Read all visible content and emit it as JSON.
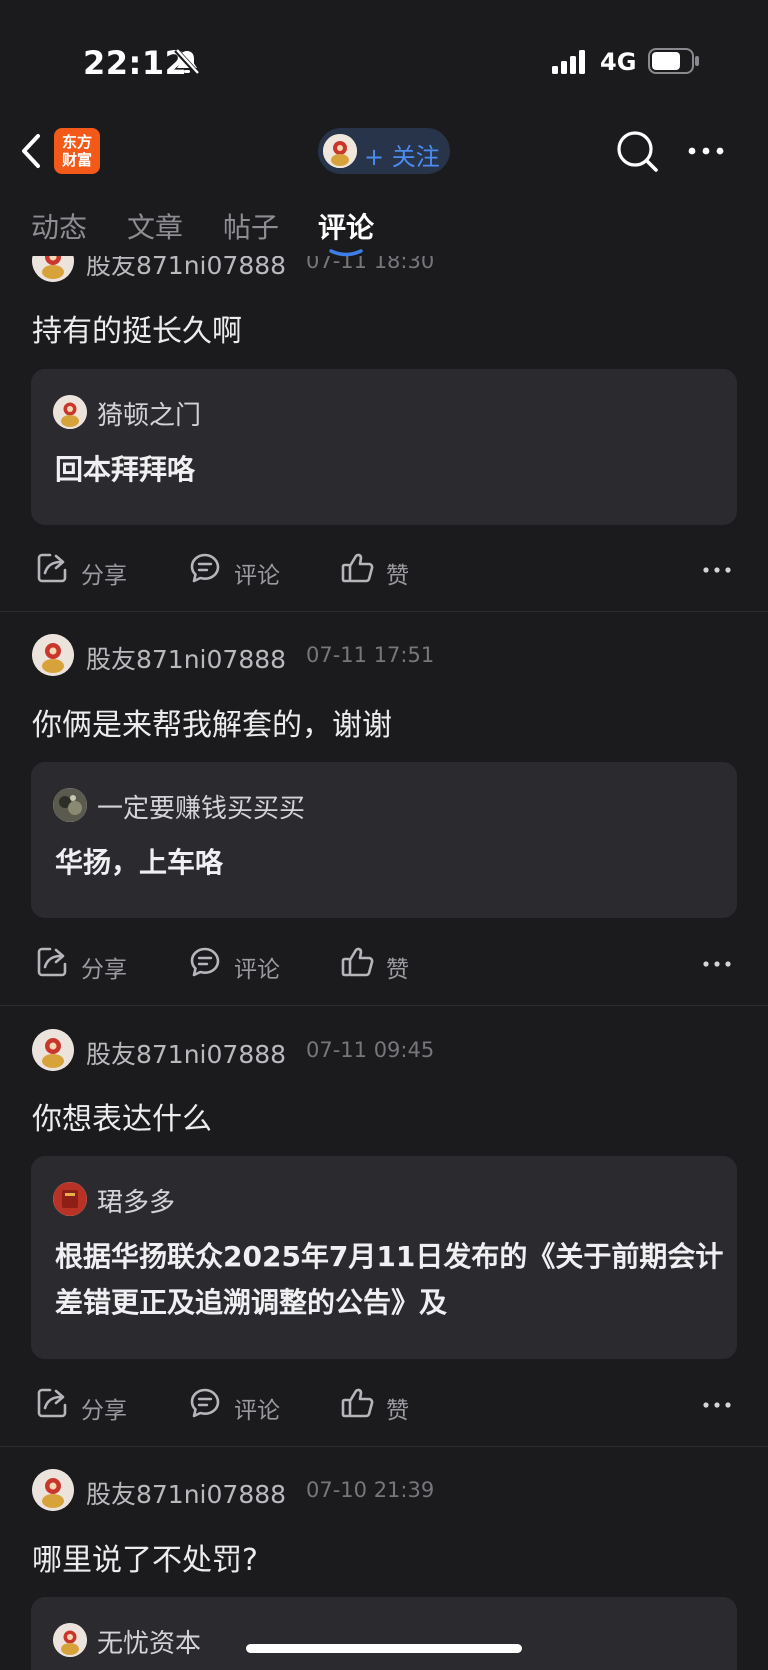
{
  "status": {
    "time": "22:12",
    "network": "4G"
  },
  "nav": {
    "logo_line1": "东方",
    "logo_line2": "财富",
    "follow_label": "+ 关注"
  },
  "tabs": [
    {
      "label": "动态"
    },
    {
      "label": "文章"
    },
    {
      "label": "帖子"
    },
    {
      "label": "评论"
    }
  ],
  "actions": {
    "share": "分享",
    "comment": "评论",
    "like": "赞"
  },
  "posts": [
    {
      "author": "股友871ni07888",
      "time": "07-11 18:30",
      "text": "持有的挺长久啊",
      "quote_author": "猗顿之门",
      "quote_text": "回本拜拜咯"
    },
    {
      "author": "股友871ni07888",
      "time": "07-11 17:51",
      "text": "你俩是来帮我解套的，谢谢",
      "quote_author": "一定要赚钱买买买",
      "quote_text": "华扬，上车咯"
    },
    {
      "author": "股友871ni07888",
      "time": "07-11 09:45",
      "text": "你想表达什么",
      "quote_author": "珺多多",
      "quote_text": "根据华扬联众2025年7月11日发布的《关于前期会计差错更正及追溯调整的公告》及"
    },
    {
      "author": "股友871ni07888",
      "time": "07-10 21:39",
      "text": "哪里说了不处罚?",
      "quote_author": "无忧资本",
      "quote_text": ""
    }
  ]
}
